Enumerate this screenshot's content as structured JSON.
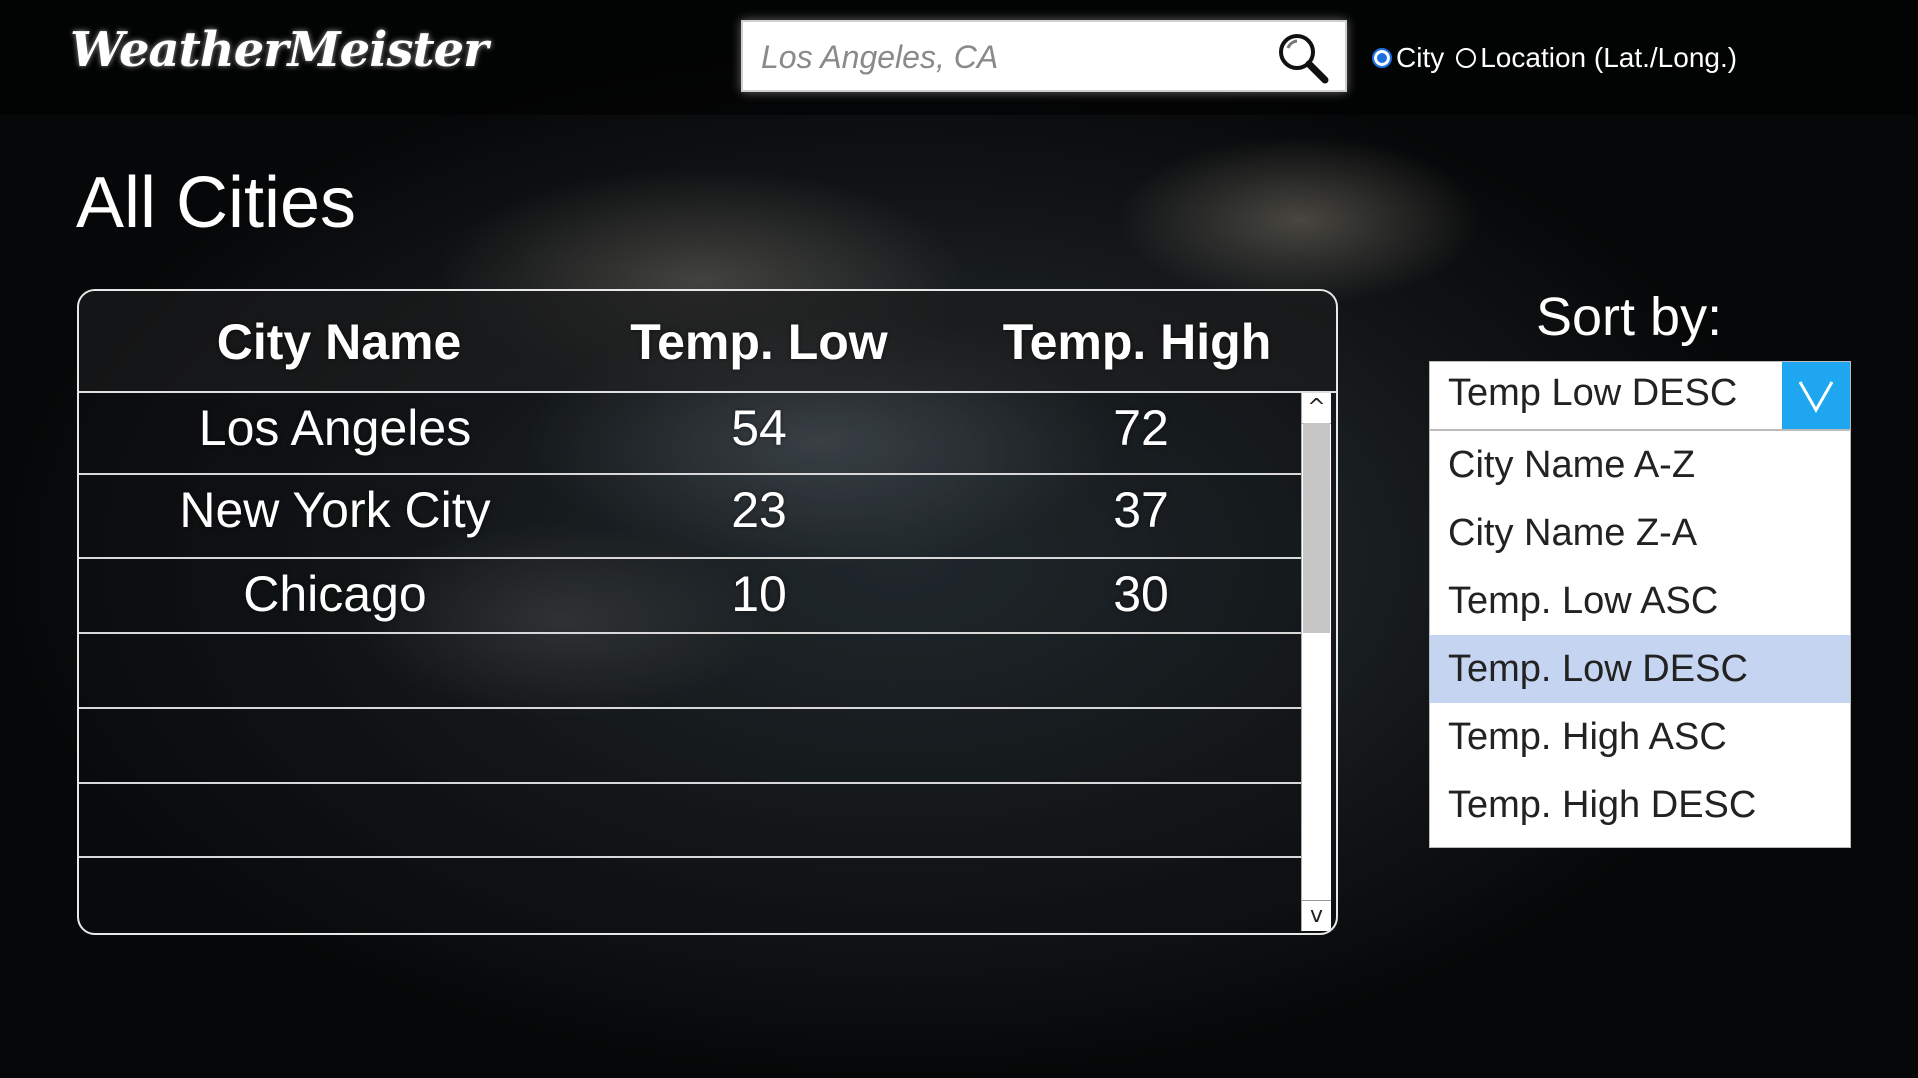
{
  "app": {
    "logo": "WeatherMeister"
  },
  "search": {
    "placeholder": "Los Angeles, CA"
  },
  "search_mode": {
    "options": [
      {
        "label": "City",
        "checked": true
      },
      {
        "label": "Location (Lat./Long.)",
        "checked": false
      }
    ]
  },
  "page": {
    "title": "All Cities"
  },
  "table": {
    "columns": [
      "City Name",
      "Temp. Low",
      "Temp. High"
    ],
    "rows": [
      [
        "Los Angeles",
        "54",
        "72"
      ],
      [
        "New York City",
        "23",
        "37"
      ],
      [
        "Chicago",
        "10",
        "30"
      ],
      [
        "",
        "",
        ""
      ],
      [
        "",
        "",
        ""
      ],
      [
        "",
        "",
        ""
      ],
      [
        "",
        "",
        ""
      ]
    ],
    "scroll_up": "^",
    "scroll_down": "v"
  },
  "sort": {
    "label": "Sort by:",
    "selected": "Temp Low DESC",
    "options": [
      {
        "label": "City Name A-Z",
        "selected": false
      },
      {
        "label": "City Name Z-A",
        "selected": false
      },
      {
        "label": "Temp. Low ASC",
        "selected": false
      },
      {
        "label": "Temp. Low DESC",
        "selected": true
      },
      {
        "label": "Temp. High ASC",
        "selected": false
      },
      {
        "label": "Temp. High DESC",
        "selected": false
      }
    ]
  },
  "colors": {
    "accent": "#1ea6f0",
    "highlight": "#c5d5f1",
    "radio_checked": "#1e6fe0"
  }
}
